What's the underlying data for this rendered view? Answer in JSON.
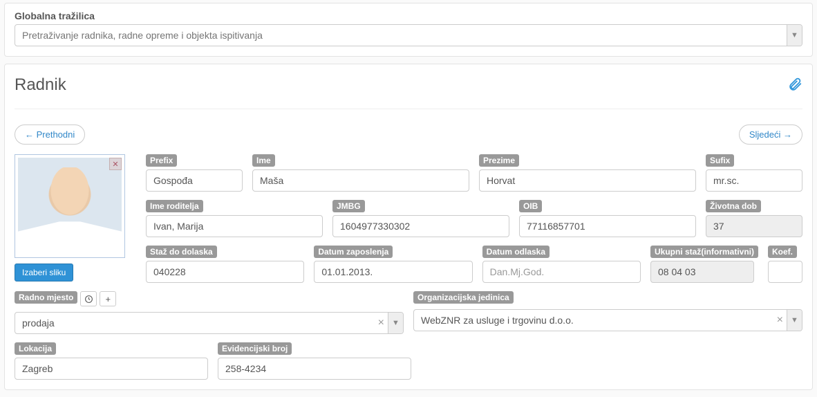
{
  "global_search": {
    "label": "Globalna tražilica",
    "placeholder": "Pretraživanje radnika, radne opreme i objekta ispitivanja"
  },
  "section_title": "Radnik",
  "nav": {
    "prev": "← Prethodni",
    "next": "Sljedeći →"
  },
  "photo": {
    "button": "Izaberi sliku"
  },
  "fields": {
    "prefix": {
      "label": "Prefix",
      "value": "Gospođa"
    },
    "ime": {
      "label": "Ime",
      "value": "Maša"
    },
    "prezime": {
      "label": "Prezime",
      "value": "Horvat"
    },
    "sufix": {
      "label": "Sufix",
      "value": "mr.sc."
    },
    "roditelj": {
      "label": "Ime roditelja",
      "value": "Ivan, Marija"
    },
    "jmbg": {
      "label": "JMBG",
      "value": "1604977330302"
    },
    "oib": {
      "label": "OIB",
      "value": "77116857701"
    },
    "dob": {
      "label": "Životna dob",
      "value": "37"
    },
    "staz": {
      "label": "Staž do dolaska",
      "value": "040228"
    },
    "zap": {
      "label": "Datum zaposlenja",
      "value": "01.01.2013."
    },
    "odl": {
      "label": "Datum odlaska",
      "placeholder": "Dan.Mj.God."
    },
    "ukstaz": {
      "label": "Ukupni staž(informativni)",
      "value": "08 04 03"
    },
    "koef": {
      "label": "Koef.",
      "value": ""
    }
  },
  "radno_mjesto": {
    "label": "Radno mjesto",
    "value": "prodaja"
  },
  "org": {
    "label": "Organizacijska jedinica",
    "value": "WebZNR za usluge i trgovinu d.o.o."
  },
  "lokacija": {
    "label": "Lokacija",
    "value": "Zagreb"
  },
  "evid": {
    "label": "Evidencijski broj",
    "value": "258-4234"
  }
}
